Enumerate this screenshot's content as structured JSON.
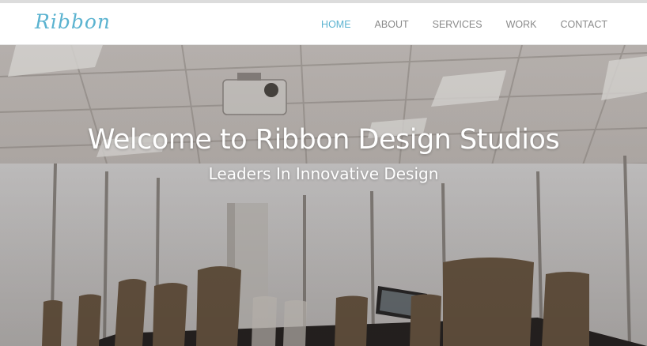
{
  "brand": {
    "logo_text": "Ribbon"
  },
  "nav": {
    "items": [
      {
        "label": "HOME",
        "active": true
      },
      {
        "label": "ABOUT",
        "active": false
      },
      {
        "label": "SERVICES",
        "active": false
      },
      {
        "label": "WORK",
        "active": false
      },
      {
        "label": "CONTACT",
        "active": false
      }
    ]
  },
  "hero": {
    "title": "Welcome to Ribbon Design Studios",
    "subtitle": "Leaders In Innovative Design",
    "background_image": "conference-room-photo"
  },
  "colors": {
    "accent": "#5bb3d0",
    "nav_text": "#8a8a8a",
    "hero_text": "#ffffff"
  }
}
